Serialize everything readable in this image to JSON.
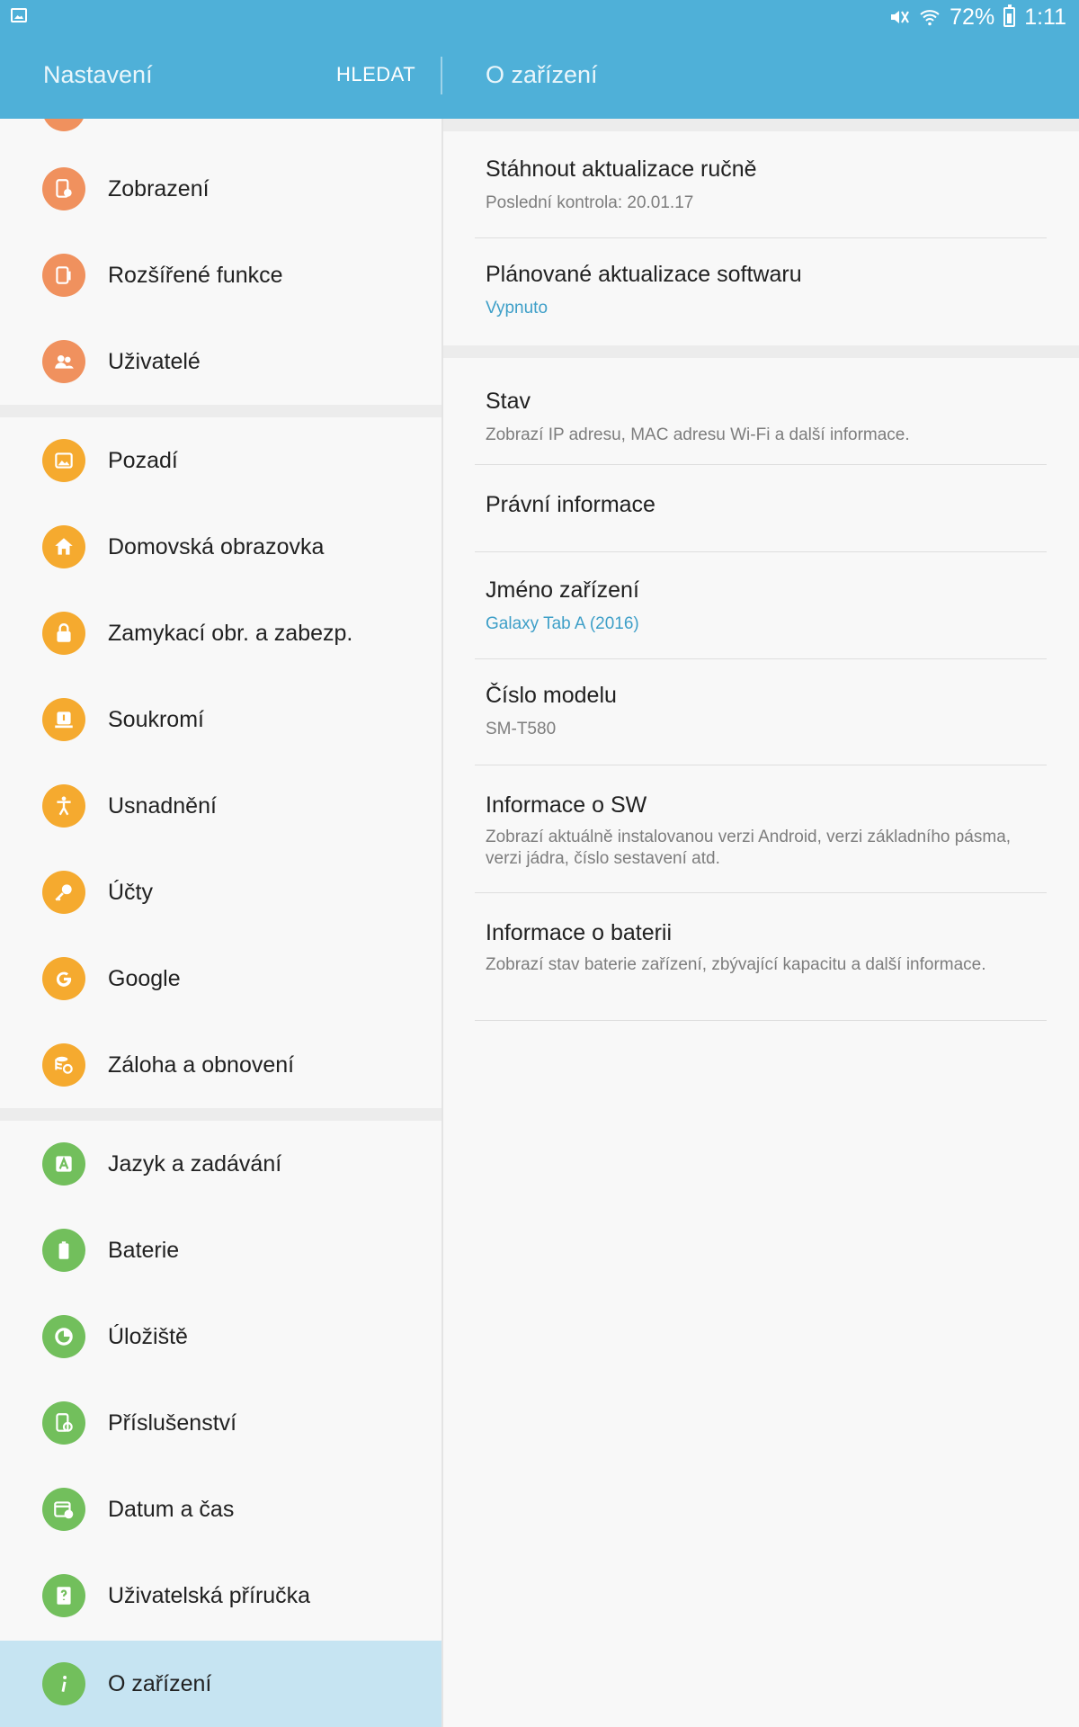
{
  "status_bar": {
    "battery_percent": "72%",
    "time": "1:11",
    "icons": [
      "gallery-notification-icon",
      "mute-icon",
      "wifi-icon",
      "battery-icon"
    ]
  },
  "header": {
    "left_title": "Nastavení",
    "search_label": "HLEDAT",
    "right_title": "O zařízení"
  },
  "colors": {
    "app_bar": "#4fb0d8",
    "selected_row": "#c6e4f2",
    "accent_text": "#3e9fc8",
    "icon_orange": "#f0915e",
    "icon_yellow": "#f5aa2f",
    "icon_green": "#72bf5c"
  },
  "sidebar": {
    "items": [
      {
        "label": "Zobrazení",
        "icon": "display-settings-icon"
      },
      {
        "label": "Rozšířené funkce",
        "icon": "advanced-features-icon"
      },
      {
        "label": "Uživatelé",
        "icon": "users-icon"
      },
      {
        "label": "Pozadí",
        "icon": "wallpaper-icon"
      },
      {
        "label": "Domovská obrazovka",
        "icon": "home-icon"
      },
      {
        "label": "Zamykací obr. a zabezp.",
        "icon": "lock-icon"
      },
      {
        "label": "Soukromí",
        "icon": "privacy-icon"
      },
      {
        "label": "Usnadnění",
        "icon": "accessibility-icon"
      },
      {
        "label": "Účty",
        "icon": "key-icon"
      },
      {
        "label": "Google",
        "icon": "google-icon"
      },
      {
        "label": "Záloha a obnovení",
        "icon": "backup-icon"
      },
      {
        "label": "Jazyk a zadávání",
        "icon": "language-icon"
      },
      {
        "label": "Baterie",
        "icon": "battery-icon"
      },
      {
        "label": "Úložiště",
        "icon": "storage-icon"
      },
      {
        "label": "Příslušenství",
        "icon": "accessories-icon"
      },
      {
        "label": "Datum a čas",
        "icon": "calendar-clock-icon"
      },
      {
        "label": "Uživatelská příručka",
        "icon": "help-icon"
      },
      {
        "label": "O zařízení",
        "icon": "info-icon",
        "selected": true
      }
    ]
  },
  "detail": {
    "items": [
      {
        "title": "Stáhnout aktualizace ručně",
        "subtitle": "Poslední kontrola: 20.01.17"
      },
      {
        "title": "Plánované aktualizace softwaru",
        "subtitle": "Vypnuto"
      },
      {
        "title": "Stav",
        "subtitle": "Zobrazí IP adresu, MAC adresu Wi-Fi a další informace."
      },
      {
        "title": "Právní informace",
        "subtitle": ""
      },
      {
        "title": "Jméno zařízení",
        "subtitle": "Galaxy Tab A (2016)"
      },
      {
        "title": "Číslo modelu",
        "subtitle": "SM-T580"
      },
      {
        "title": "Informace o SW",
        "subtitle": "Zobrazí aktuálně instalovanou verzi Android, verzi základního pásma, verzi jádra, číslo sestavení atd."
      },
      {
        "title": "Informace o baterii",
        "subtitle": "Zobrazí stav baterie zařízení, zbývající kapacitu a další informace."
      }
    ]
  }
}
